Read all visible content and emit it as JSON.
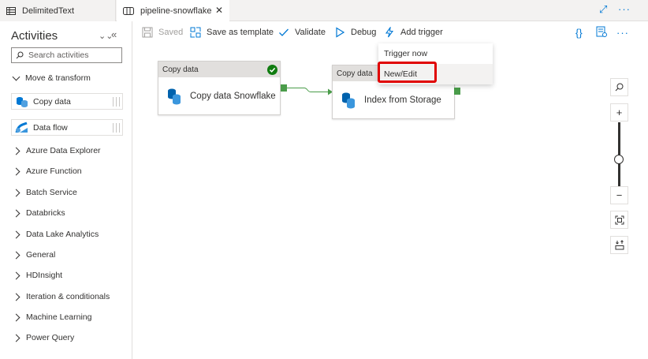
{
  "tabs": [
    {
      "label": "DelimitedText",
      "icon": "table-icon"
    },
    {
      "label": "pipeline-snowflake",
      "icon": "pipeline-icon"
    }
  ],
  "toolbar": {
    "saved_label": "Saved",
    "save_template_label": "Save as template",
    "validate_label": "Validate",
    "debug_label": "Debug",
    "add_trigger_label": "Add trigger"
  },
  "activities": {
    "title": "Activities",
    "search_placeholder": "Search activities",
    "expanded_section": "Move & transform",
    "items": [
      "Copy data",
      "Data flow"
    ],
    "sections": [
      "Azure Data Explorer",
      "Azure Function",
      "Batch Service",
      "Databricks",
      "Data Lake Analytics",
      "General",
      "HDInsight",
      "Iteration & conditionals",
      "Machine Learning",
      "Power Query"
    ]
  },
  "canvas": {
    "node1": {
      "type": "Copy data",
      "name": "Copy data Snowflake",
      "status": "success"
    },
    "node2": {
      "type": "Copy data",
      "name": "Index from Storage"
    }
  },
  "trigger_menu": {
    "items": [
      "Trigger now",
      "New/Edit"
    ],
    "highlighted": "New/Edit"
  },
  "colors": {
    "accent": "#0078d4",
    "success": "#107c10",
    "highlight": "#e00000",
    "connector": "#4a9c4a"
  }
}
